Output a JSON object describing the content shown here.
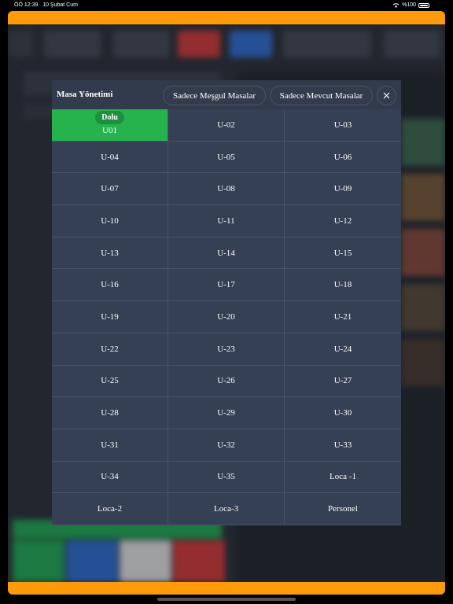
{
  "status_bar": {
    "time": "ÖÖ 12:39",
    "date": "10 Şubat Cum",
    "battery": "%100"
  },
  "modal": {
    "title": "Masa Yönetimi",
    "filter_busy": "Sadece Meşgul Masalar",
    "filter_available": "Sadece Mevcut Masalar",
    "close_icon": "close-icon",
    "occupied_badge": "Dolu",
    "tables": [
      {
        "label": "U01",
        "occupied": true
      },
      {
        "label": "U-02",
        "occupied": false
      },
      {
        "label": "U-03",
        "occupied": false
      },
      {
        "label": "U-04",
        "occupied": false
      },
      {
        "label": "U-05",
        "occupied": false
      },
      {
        "label": "U-06",
        "occupied": false
      },
      {
        "label": "U-07",
        "occupied": false
      },
      {
        "label": "U-08",
        "occupied": false
      },
      {
        "label": "U-09",
        "occupied": false
      },
      {
        "label": "U-10",
        "occupied": false
      },
      {
        "label": "U-11",
        "occupied": false
      },
      {
        "label": "U-12",
        "occupied": false
      },
      {
        "label": "U-13",
        "occupied": false
      },
      {
        "label": "U-14",
        "occupied": false
      },
      {
        "label": "U-15",
        "occupied": false
      },
      {
        "label": "U-16",
        "occupied": false
      },
      {
        "label": "U-17",
        "occupied": false
      },
      {
        "label": "U-18",
        "occupied": false
      },
      {
        "label": "U-19",
        "occupied": false
      },
      {
        "label": "U-20",
        "occupied": false
      },
      {
        "label": "U-21",
        "occupied": false
      },
      {
        "label": "U-22",
        "occupied": false
      },
      {
        "label": "U-23",
        "occupied": false
      },
      {
        "label": "U-24",
        "occupied": false
      },
      {
        "label": "U-25",
        "occupied": false
      },
      {
        "label": "U-26",
        "occupied": false
      },
      {
        "label": "U-27",
        "occupied": false
      },
      {
        "label": "U-28",
        "occupied": false
      },
      {
        "label": "U-29",
        "occupied": false
      },
      {
        "label": "U-30",
        "occupied": false
      },
      {
        "label": "U-31",
        "occupied": false
      },
      {
        "label": "U-32",
        "occupied": false
      },
      {
        "label": "U-33",
        "occupied": false
      },
      {
        "label": "U-34",
        "occupied": false
      },
      {
        "label": "U-35",
        "occupied": false
      },
      {
        "label": "Loca -1",
        "occupied": false
      },
      {
        "label": "Loca-2",
        "occupied": false
      },
      {
        "label": "Loca-3",
        "occupied": false
      },
      {
        "label": "Personel",
        "occupied": false
      }
    ]
  },
  "colors": {
    "frame_accent": "#ff9a0a",
    "occupied": "#26b34e",
    "occupied_badge": "#1e8f3e",
    "cell": "#354055",
    "header": "#323b4b"
  }
}
